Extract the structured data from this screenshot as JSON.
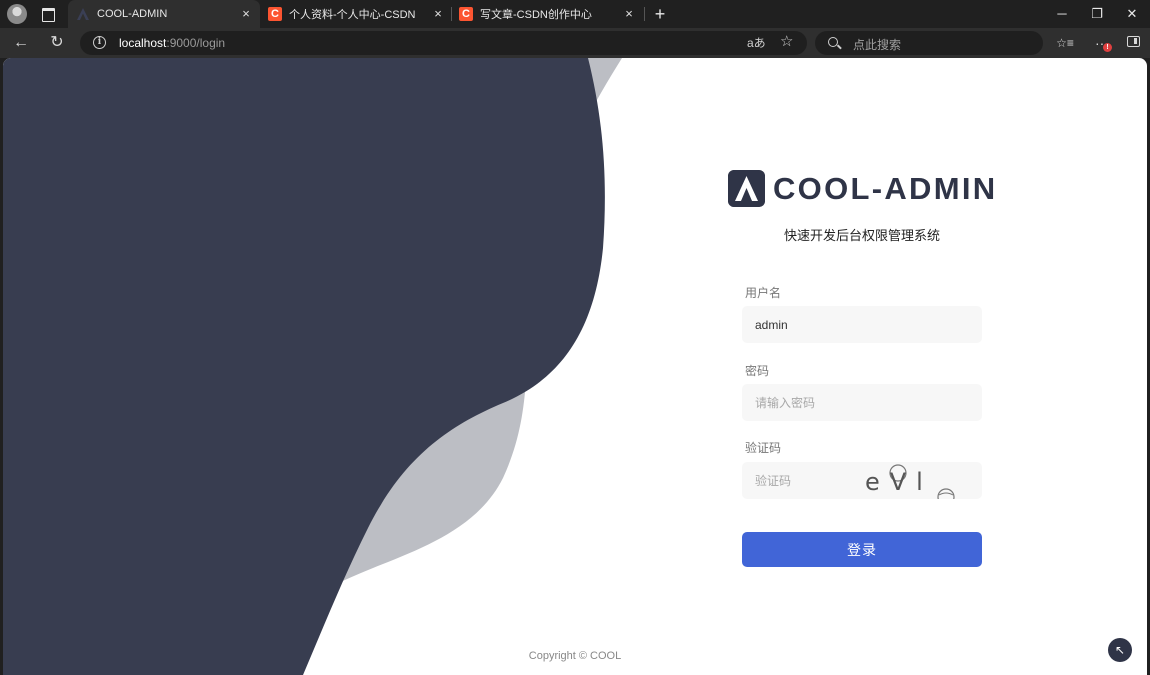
{
  "browser": {
    "tabs": [
      {
        "title": "COOL-ADMIN",
        "active": true
      },
      {
        "title": "个人资料-个人中心-CSDN",
        "favicon_text": "C"
      },
      {
        "title": "写文章-CSDN创作中心",
        "favicon_text": "C"
      }
    ],
    "tab_close_glyph": "×",
    "new_tab_glyph": "+",
    "window_controls": {
      "minimize": "─",
      "restore": "❐",
      "close": "✕"
    },
    "url": {
      "host": "localhost",
      "rest": ":9000/login"
    },
    "search_placeholder": "点此搜索",
    "read_aloud_glyph": "aあ",
    "favorite_glyph": "☆",
    "favorites_glyph": "☆≡",
    "more_glyph": "···",
    "notification_badge": "!",
    "accent_color": "#2f3447"
  },
  "login": {
    "brand_name": "COOL-ADMIN",
    "subtitle": "快速开发后台权限管理系统",
    "username_label": "用户名",
    "username_value": "admin",
    "password_label": "密码",
    "password_placeholder": "请输入密码",
    "captcha_label": "验证码",
    "captcha_placeholder": "验证码",
    "captcha_text": "eVl",
    "submit_label": "登录",
    "button_color": "#4165d7",
    "copyright": "Copyright © COOL",
    "scroll_top_glyph": "↖"
  }
}
